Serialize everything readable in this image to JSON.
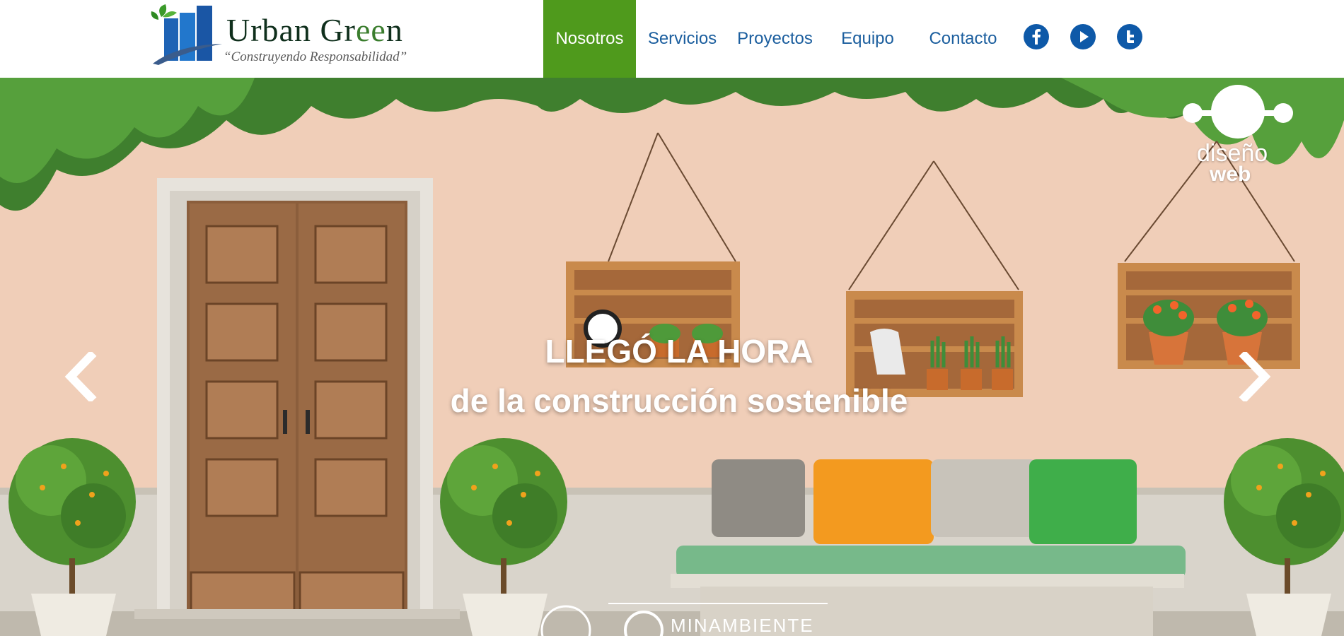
{
  "header": {
    "logo": {
      "brand_part1": "Urban Gr",
      "brand_part2": "ee",
      "brand_part3": "n",
      "tagline": "“Construyendo Responsabilidad”"
    },
    "nav": [
      {
        "label": "Nosotros",
        "active": true
      },
      {
        "label": "Servicios",
        "active": false
      },
      {
        "label": "Proyectos",
        "active": false
      },
      {
        "label": "Equipo",
        "active": false
      },
      {
        "label": "Contacto",
        "active": false
      }
    ],
    "social_icons": [
      "facebook-icon",
      "play-icon",
      "twitter-icon"
    ]
  },
  "hero": {
    "headline_line1": "LLEGÓ LA HORA",
    "headline_line2": "de la construcción sostenible",
    "watermark_line1": "diseño",
    "watermark_line2": "web",
    "partner_text": "MINAMBIENTE",
    "prev_icon": "chevron-left-icon",
    "next_icon": "chevron-right-icon"
  },
  "colors": {
    "nav_active_bg": "#4f9a1c",
    "nav_text": "#1b5e9e",
    "social_bg": "#0e59a8",
    "wall": "#efc9b3"
  }
}
